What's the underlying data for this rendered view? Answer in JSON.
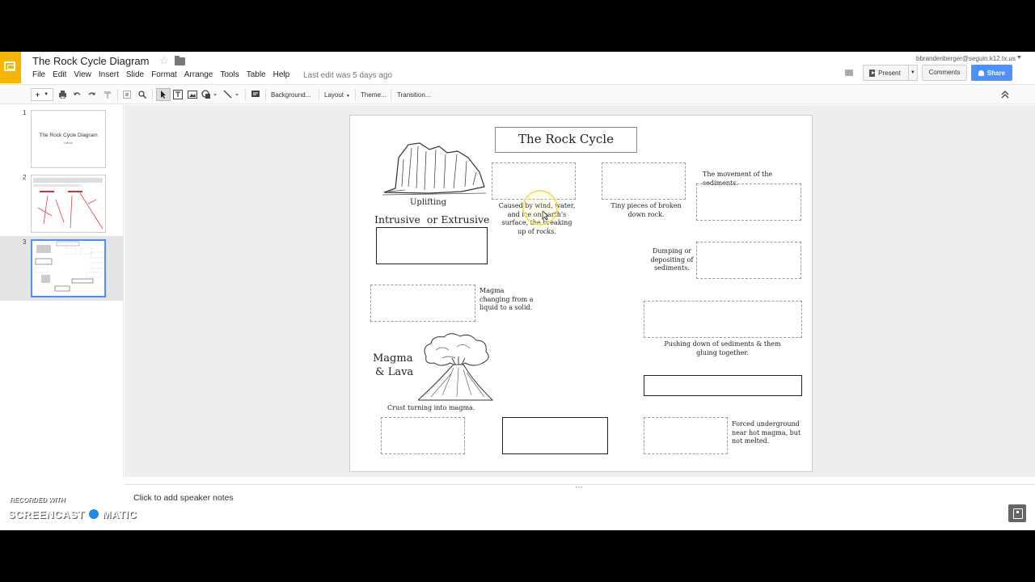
{
  "app": {
    "doc_title": "The Rock Cycle Diagram",
    "menus": [
      "File",
      "Edit",
      "View",
      "Insert",
      "Slide",
      "Format",
      "Arrange",
      "Tools",
      "Table",
      "Help"
    ],
    "last_edit": "Last edit was 5 days ago",
    "user_email": "bbrandenberger@seguin.k12.tx.us",
    "present_label": "Present",
    "comments_label": "Comments",
    "share_label": "Share",
    "accent_color": "#f4b400",
    "share_color": "#4d90fe"
  },
  "toolbar": {
    "add_label": "+",
    "background_label": "Background...",
    "layout_label": "Layout",
    "theme_label": "Theme...",
    "transition_label": "Transition..."
  },
  "filmstrip": {
    "slides": [
      {
        "number": "1",
        "title": "The Rock Cycle Diagram",
        "subtitle": "Name"
      },
      {
        "number": "2"
      },
      {
        "number": "3",
        "selected": true
      }
    ]
  },
  "slide": {
    "title": "The Rock Cycle",
    "labels": {
      "uplifting": "Uplifting",
      "intrusive": "Intrusive  or Extrusive",
      "magma_lava_1": "Magma",
      "magma_lava_2": "& Lava",
      "crust": "Crust turning into magma.",
      "weathering": "Caused by wind, water, and ice on earth's surface, the breaking up of rocks.",
      "erosion_hint": "Tiny pieces of broken down rock.",
      "movement": "The movement of the sediments.",
      "deposition": "Dumping or depositing of sediments.",
      "cooling": "Magma changing from a liquid to a solid.",
      "compaction": "Pushing down of sediments & them gluing together.",
      "metamorphism": "Forced underground near hot magma, but not melted."
    }
  },
  "notes": {
    "placeholder": "Click to add speaker notes"
  },
  "watermark": {
    "line1": "RECORDED WITH",
    "line2_a": "SCREENCAST",
    "line2_b": "MATIC"
  }
}
